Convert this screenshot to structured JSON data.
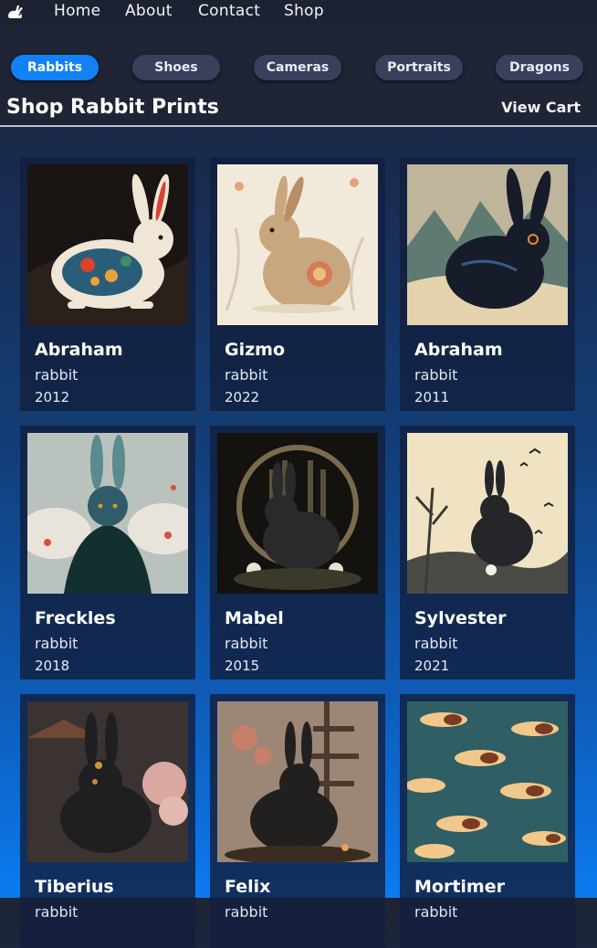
{
  "nav": {
    "links": [
      "Home",
      "About",
      "Contact",
      "Shop"
    ]
  },
  "filters": [
    "Rabbits",
    "Shoes",
    "Cameras",
    "Portraits",
    "Dragons"
  ],
  "active_filter": "Rabbits",
  "header": {
    "title": "Shop Rabbit Prints",
    "cart_label": "View Cart"
  },
  "products": [
    {
      "name": "Abraham",
      "kind": "rabbit",
      "year": "2012"
    },
    {
      "name": "Gizmo",
      "kind": "rabbit",
      "year": "2022"
    },
    {
      "name": "Abraham",
      "kind": "rabbit",
      "year": "2011"
    },
    {
      "name": "Freckles",
      "kind": "rabbit",
      "year": "2018"
    },
    {
      "name": "Mabel",
      "kind": "rabbit",
      "year": "2015"
    },
    {
      "name": "Sylvester",
      "kind": "rabbit",
      "year": "2021"
    },
    {
      "name": "Tiberius",
      "kind": "rabbit",
      "year": ""
    },
    {
      "name": "Felix",
      "kind": "rabbit",
      "year": ""
    },
    {
      "name": "Mortimer",
      "kind": "rabbit",
      "year": ""
    }
  ],
  "colors": {
    "accent": "#1281f5",
    "pill": "#3a3f5c",
    "nav_bg": "#1c2232"
  }
}
